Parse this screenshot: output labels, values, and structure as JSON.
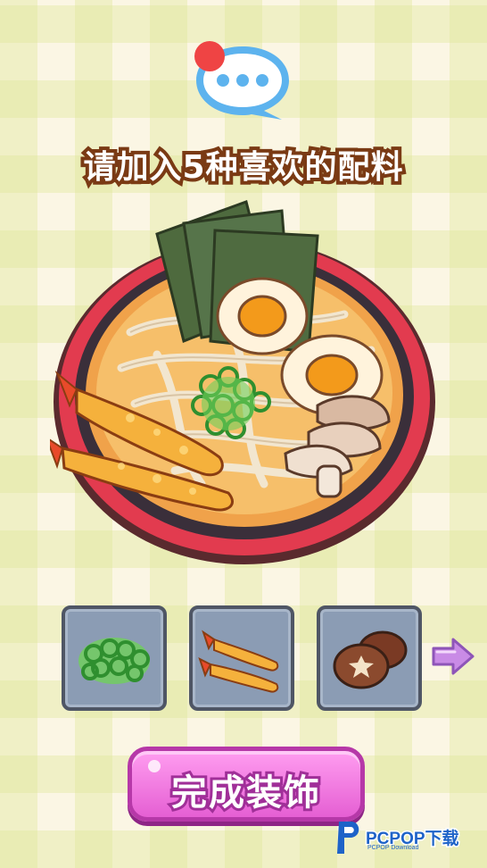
{
  "header": {
    "chat_icon": "chat-bubble-icon",
    "notification_dot_color": "#ef4444"
  },
  "prompt": {
    "text": "请加入5种喜欢的配料"
  },
  "bowl": {
    "dish": "ramen",
    "toppings_shown": [
      "nori",
      "egg",
      "green-onion",
      "shrimp-tempura",
      "mushroom"
    ]
  },
  "ingredient_tray": {
    "items": [
      {
        "icon": "green-onion-icon"
      },
      {
        "icon": "shrimp-tempura-icon"
      },
      {
        "icon": "shiitake-mushroom-icon"
      }
    ],
    "next_icon": "arrow-right-icon"
  },
  "actions": {
    "done_label": "完成装饰"
  },
  "watermark": {
    "brand": "PCPOP下载",
    "tagline": "PCPOP Download"
  },
  "colors": {
    "button_pink": "#e55fd3",
    "slot_bg": "#8b9cb4",
    "bowl_red": "#e23b4f",
    "title_outline": "#7a3a14"
  }
}
